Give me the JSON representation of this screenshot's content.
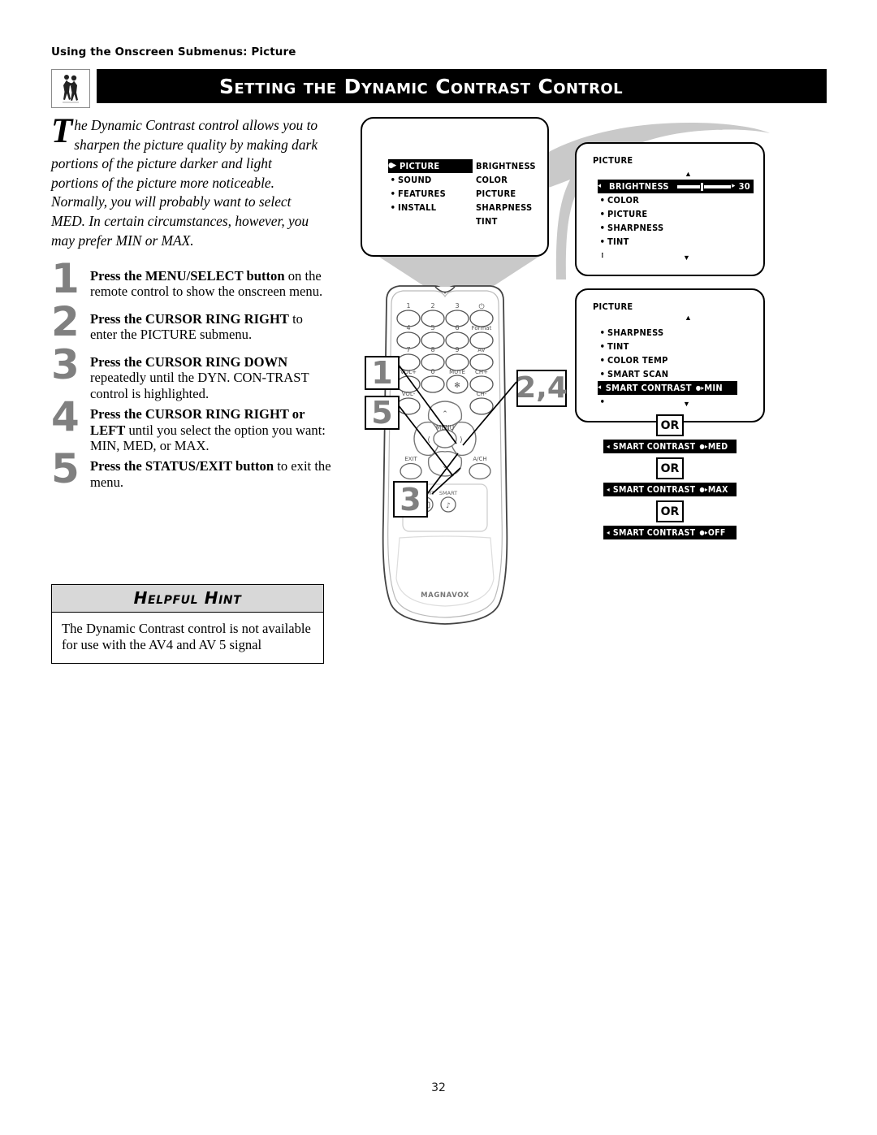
{
  "page": {
    "running_head": "Using the Onscreen Submenus: Picture",
    "title": "Setting the Dynamic Contrast Control",
    "page_number": "32",
    "chapter_icon": "two-people-icon"
  },
  "intro": {
    "dropcap": "T",
    "text": "he Dynamic Contrast control allows you to sharpen the picture quality by making dark portions of the picture darker and light portions of the picture more noticeable. Normally, you will probably want to select MED. In certain circumstances, however, you may prefer MIN or MAX."
  },
  "steps": [
    {
      "number": "1",
      "bold": "Press the MENU/SELECT button",
      "rest": " on the remote control to show the onscreen menu."
    },
    {
      "number": "2",
      "bold": "Press the CURSOR RING RIGHT",
      "rest": " to enter the PICTURE submenu."
    },
    {
      "number": "3",
      "bold": "Press the CURSOR RING DOWN",
      "rest": " repeatedly until the DYN. CON-TRAST control is highlighted."
    },
    {
      "number": "4",
      "bold": "Press the CURSOR RING RIGHT or LEFT",
      "rest": " until you select the option you want: MIN, MED, or MAX."
    },
    {
      "number": "5",
      "bold": "Press the STATUS/EXIT button",
      "rest": " to exit the menu."
    }
  ],
  "hint": {
    "heading": "Helpful Hint",
    "body": "The Dynamic Contrast control is not available for use with the AV4 and AV 5 signal"
  },
  "screen1": {
    "left_items": [
      {
        "label": "PICTURE",
        "selected": true
      },
      {
        "label": "SOUND",
        "selected": false
      },
      {
        "label": "FEATURES",
        "selected": false
      },
      {
        "label": "INSTALL",
        "selected": false
      }
    ],
    "right_items": [
      "BRIGHTNESS",
      "COLOR",
      "PICTURE",
      "SHARPNESS",
      "TINT"
    ]
  },
  "screen2": {
    "title": "PICTURE",
    "scroll_up": "▲",
    "scroll_down": "▼",
    "items": [
      {
        "label": "BRIGHTNESS",
        "selected": true,
        "value": "30",
        "slider": true
      },
      {
        "label": "COLOR",
        "selected": false
      },
      {
        "label": "PICTURE",
        "selected": false
      },
      {
        "label": "SHARPNESS",
        "selected": false
      },
      {
        "label": "TINT",
        "selected": false
      }
    ],
    "brightness_value": "30"
  },
  "screen3": {
    "title": "PICTURE",
    "scroll_up": "▲",
    "scroll_down": "▼",
    "items": [
      {
        "label": "SHARPNESS",
        "selected": false
      },
      {
        "label": "TINT",
        "selected": false
      },
      {
        "label": "COLOR TEMP",
        "selected": false
      },
      {
        "label": "SMART SCAN",
        "selected": false
      },
      {
        "label": "SMART CONTRAST",
        "selected": true,
        "value": "MIN"
      }
    ]
  },
  "or_chain": {
    "or_label": "OR",
    "options": [
      {
        "label": "SMART CONTRAST",
        "value": "MED"
      },
      {
        "label": "SMART CONTRAST",
        "value": "MAX"
      },
      {
        "label": "SMART CONTRAST",
        "value": "OFF"
      }
    ]
  },
  "remote": {
    "brand": "MAGNAVOX",
    "keypad": [
      [
        "1",
        "2",
        "3",
        "⏻"
      ],
      [
        "4",
        "5",
        "6",
        "Format"
      ],
      [
        "7",
        "8",
        "9",
        "AV"
      ],
      [
        "VOL+",
        "0",
        "MUTE",
        "CH+"
      ]
    ],
    "vol_minus": "VOL-",
    "ch_minus": "CH-",
    "menu_label": "MENU",
    "exit_label": "EXIT",
    "ach_label": "A/CH",
    "smart_picture_label": "SMART",
    "smart_sound_label": "SMART"
  },
  "callouts": [
    {
      "id": "callout-1",
      "text": "1"
    },
    {
      "id": "callout-5",
      "text": "5"
    },
    {
      "id": "callout-3",
      "text": "3"
    },
    {
      "id": "callout-24",
      "text": "2,4"
    }
  ],
  "colors": {
    "title_bar_bg": "#000000",
    "title_text": "#ffffff",
    "step_number": "#808080",
    "hint_header_bg": "#d8d8d8",
    "swoosh_gray": "#c9c9c9",
    "osd_highlight_bg": "#000000"
  }
}
